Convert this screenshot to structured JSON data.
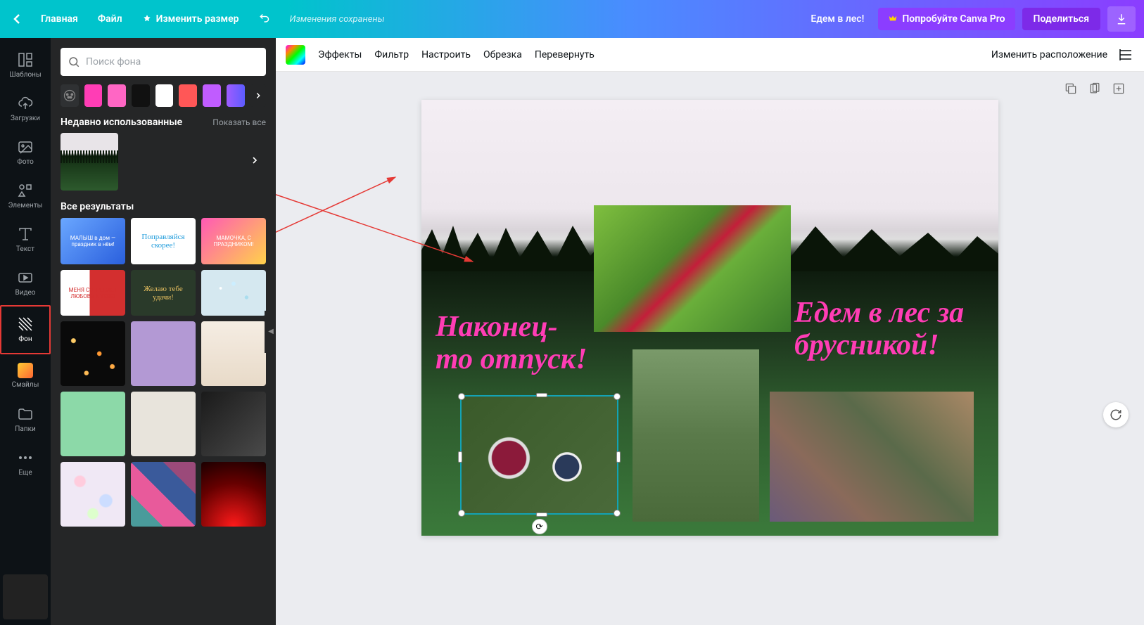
{
  "topbar": {
    "home": "Главная",
    "file": "Файл",
    "resize": "Изменить размер",
    "status": "Изменения сохранены",
    "title": "Едем в лес!",
    "try_pro": "Попробуйте Canva Pro",
    "share": "Поделиться"
  },
  "rail": {
    "templates": "Шаблоны",
    "uploads": "Загрузки",
    "photo": "Фото",
    "elements": "Элементы",
    "text": "Текст",
    "video": "Видео",
    "background": "Фон",
    "emoji": "Смайлы",
    "folders": "Папки",
    "more": "Еще"
  },
  "panel": {
    "search_placeholder": "Поиск фона",
    "recent_label": "Недавно использованные",
    "show_all": "Показать все",
    "all_results": "Все результаты",
    "swatches": [
      "#ff3db5",
      "#ff66c4",
      "#111111",
      "#ffffff",
      "#ff5757",
      "#c05cff"
    ],
    "template_cards": {
      "c1": "МАЛЫШ в дом — праздник в нём!",
      "c2": "Поправляйся скорее!",
      "c3": "МАМОЧКА, С ПРАЗДНИКОМ!",
      "c4": "МЕНЯ СОГРЕВАЕТ ЛЮБОВЬ К ТЕБЕ!",
      "c5": "Желаю тебе удачи!"
    }
  },
  "ctx": {
    "effects": "Эффекты",
    "filter": "Фильтр",
    "adjust": "Настроить",
    "crop": "Обрезка",
    "flip": "Перевернуть",
    "position": "Изменить расположение"
  },
  "design": {
    "text1": "Наконец-то отпуск!",
    "text2": "Едем в лес за брусникой!"
  }
}
